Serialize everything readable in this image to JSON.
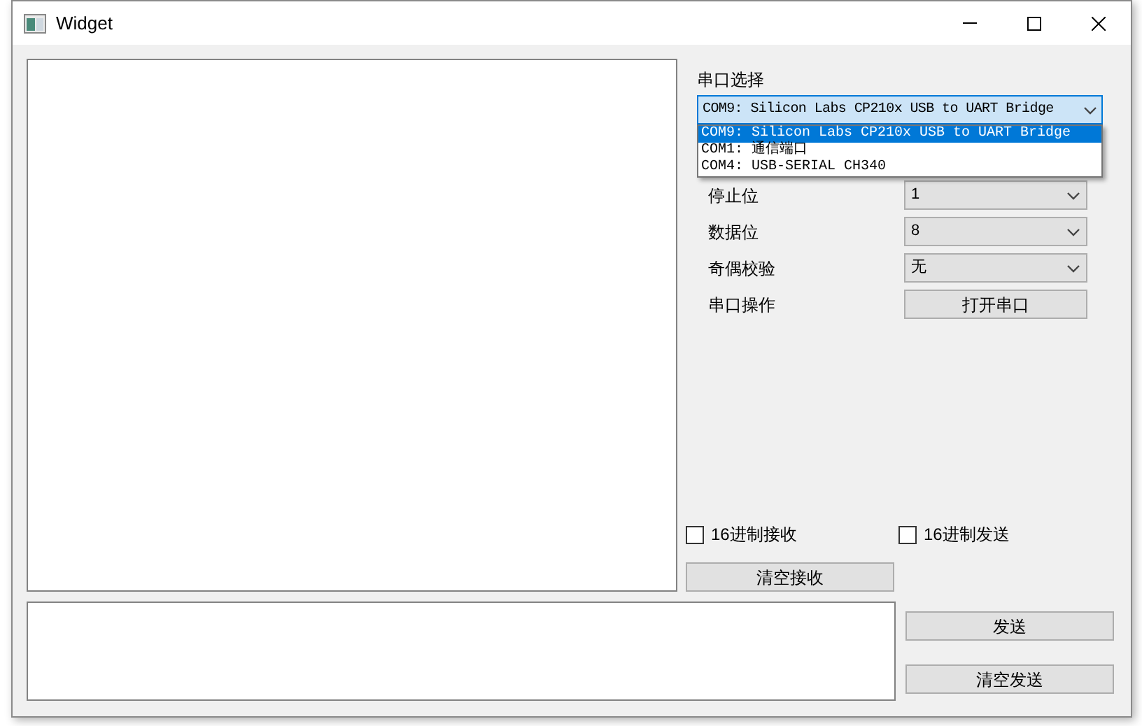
{
  "window": {
    "title": "Widget"
  },
  "port": {
    "label": "串口选择",
    "value": "COM9: Silicon Labs CP210x USB to UART Bridge",
    "expanded": true,
    "options": [
      {
        "label": "COM9: Silicon Labs CP210x USB to UART Bridge",
        "selected": true
      },
      {
        "label": "COM1: 通信端口",
        "selected": false
      },
      {
        "label": "COM4: USB-SERIAL CH340",
        "selected": false
      }
    ]
  },
  "settings": [
    {
      "kind": "select",
      "label": "停止位",
      "value": "1"
    },
    {
      "kind": "select",
      "label": "数据位",
      "value": "8"
    },
    {
      "kind": "select",
      "label": "奇偶校验",
      "value": "无"
    },
    {
      "kind": "button",
      "label": "串口操作",
      "value": "打开串口"
    }
  ],
  "checkboxes": [
    {
      "label": "16进制接收",
      "checked": false
    },
    {
      "label": "16进制发送",
      "checked": false
    }
  ],
  "clear_receive": "清空接收",
  "send_buttons": [
    "发送",
    "清空发送"
  ]
}
